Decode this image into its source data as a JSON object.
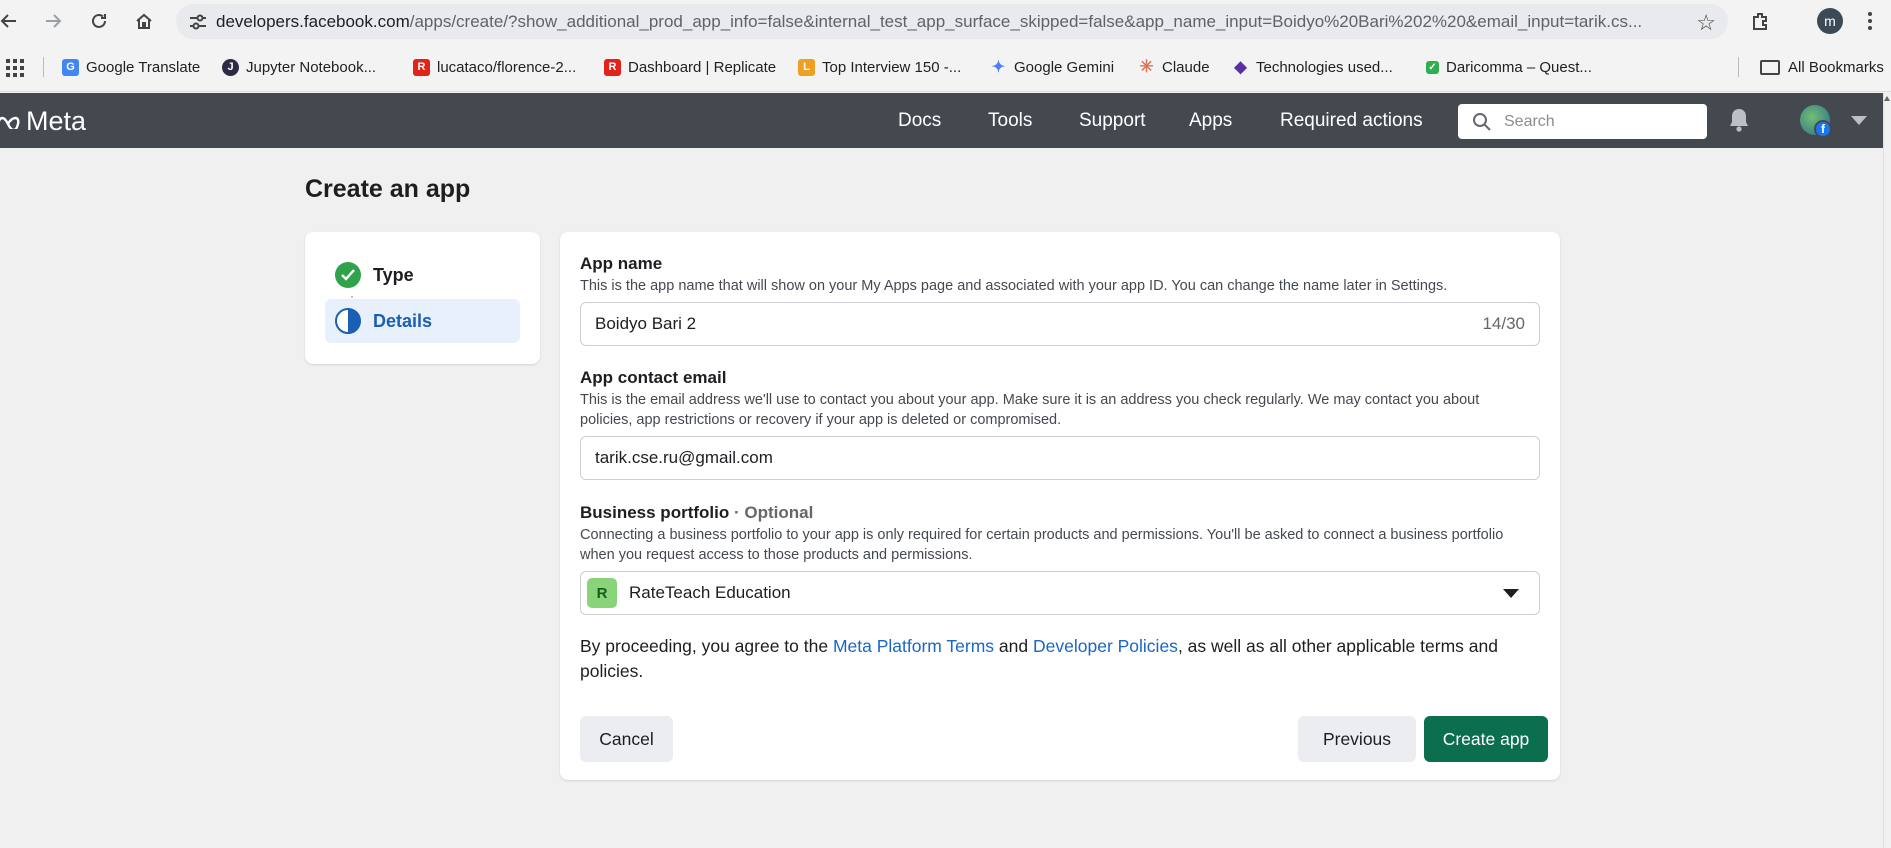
{
  "browser": {
    "url_host": "developers.facebook.com",
    "url_path": "/apps/create/?show_additional_prod_app_info=false&internal_test_app_surface_skipped=false&app_name_input=Boidyo%20Bari%202%20&email_input=tarik.cs...",
    "profile_initial": "m",
    "bookmarks": [
      {
        "label": "Google Translate",
        "color": "#4285f4",
        "glyph": "G"
      },
      {
        "label": "Jupyter Notebook...",
        "color": "#2b2b45",
        "glyph": "J"
      },
      {
        "label": "lucataco/florence-2...",
        "color": "#e2231a",
        "glyph": "R"
      },
      {
        "label": "Dashboard | Replicate",
        "color": "#e2231a",
        "glyph": "R"
      },
      {
        "label": "Top Interview 150 -...",
        "color": "#f0a020",
        "glyph": "L"
      },
      {
        "label": "Google Gemini",
        "color": "#4f7df3",
        "glyph": "✦"
      },
      {
        "label": "Claude",
        "color": "#d97757",
        "glyph": "✳"
      },
      {
        "label": "Technologies used...",
        "color": "#5b2ea6",
        "glyph": "◆"
      },
      {
        "label": "Daricomma – Quest...",
        "color": "#2eae4d",
        "glyph": "✓"
      }
    ],
    "all_bookmarks_label": "All Bookmarks"
  },
  "meta_header": {
    "logo_text": "Meta",
    "nav": [
      "Docs",
      "Tools",
      "Support",
      "Apps",
      "Required actions"
    ],
    "search_placeholder": "Search"
  },
  "page": {
    "title": "Create an app",
    "steps": [
      {
        "label": "Type",
        "state": "complete"
      },
      {
        "label": "Details",
        "state": "active"
      }
    ]
  },
  "form": {
    "app_name": {
      "label": "App name",
      "description": "This is the app name that will show on your My Apps page and associated with your app ID. You can change the name later in Settings.",
      "value": "Boidyo Bari 2",
      "counter": "14/30"
    },
    "email": {
      "label": "App contact email",
      "description": "This is the email address we'll use to contact you about your app. Make sure it is an address you check regularly. We may contact you about policies, app restrictions or recovery if your app is deleted or compromised.",
      "value": "tarik.cse.ru@gmail.com"
    },
    "business": {
      "label": "Business portfolio",
      "optional": "· Optional",
      "description": "Connecting a business portfolio to your app is only required for certain products and permissions. You'll be asked to connect a business portfolio when you request access to those products and permissions.",
      "badge": "R",
      "selected": "RateTeach Education"
    },
    "terms": {
      "prefix": "By proceeding, you agree to the ",
      "link1": "Meta Platform Terms",
      "middle": " and ",
      "link2": "Developer Policies",
      "suffix": ", as well as all other applicable terms and policies."
    },
    "buttons": {
      "cancel": "Cancel",
      "previous": "Previous",
      "create": "Create app"
    }
  },
  "colors": {
    "meta_bar": "#444950",
    "create_button": "#0b6e4f",
    "link": "#1a66c5",
    "step_active_bg": "#e7f0fb",
    "check_green": "#31a24c"
  }
}
